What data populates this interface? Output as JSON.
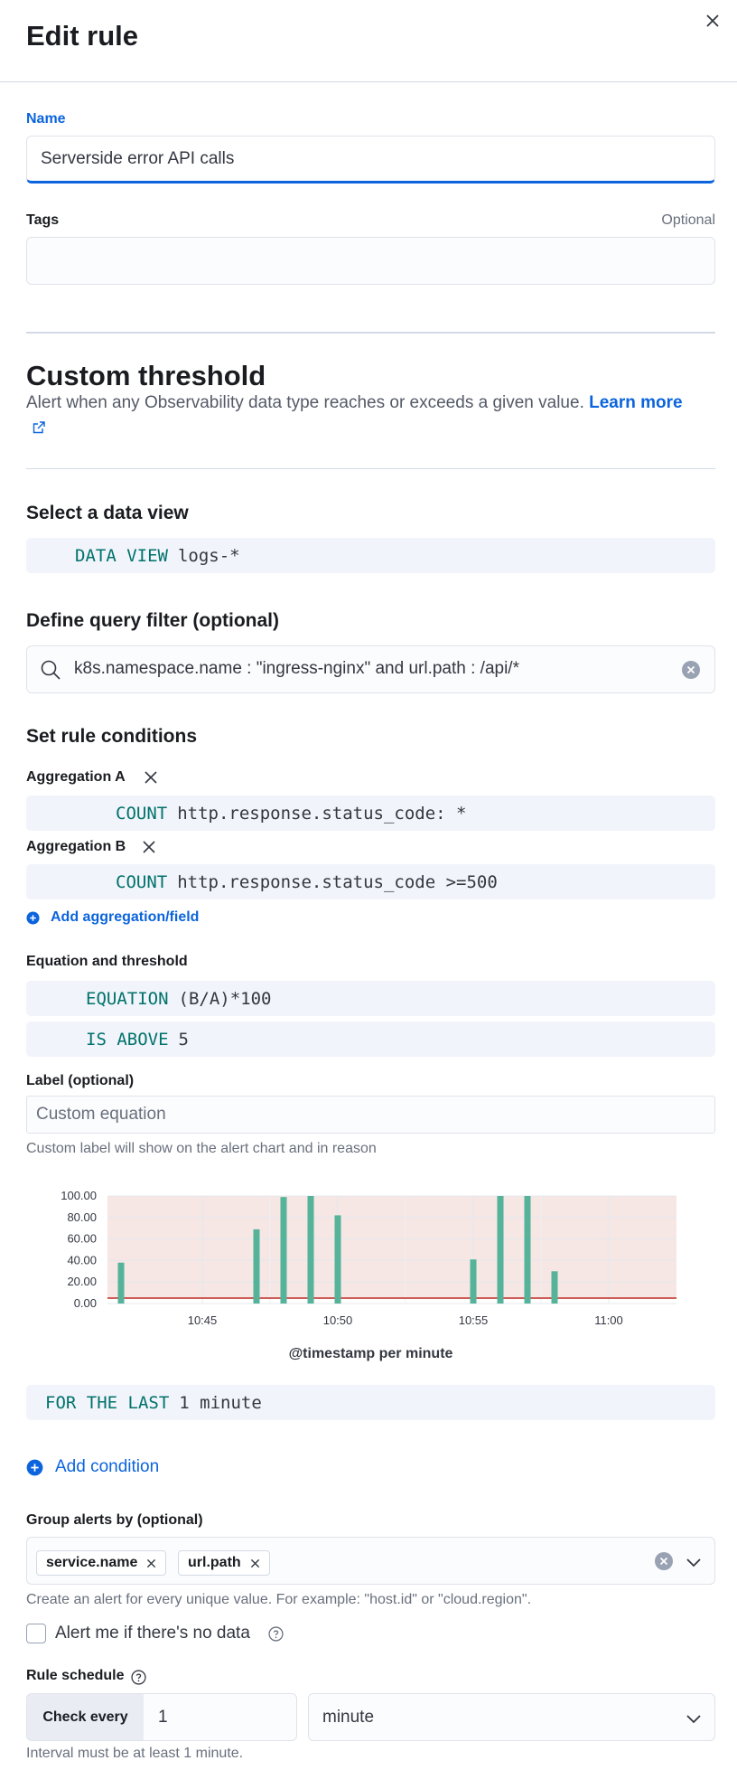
{
  "flyout": {
    "title": "Edit rule"
  },
  "name_field": {
    "label": "Name",
    "value": "Serverside error API calls"
  },
  "tags_field": {
    "label": "Tags",
    "optional": "Optional",
    "value": ""
  },
  "rule_type": {
    "title": "Custom threshold",
    "description": "Alert when any Observability data type reaches or exceeds a given value.",
    "learn_more": "Learn more"
  },
  "data_view": {
    "heading": "Select a data view",
    "keyword": "DATA VIEW",
    "value": "logs-*"
  },
  "query_filter": {
    "heading": "Define query filter (optional)",
    "query": "k8s.namespace.name : \"ingress-nginx\" and url.path : /api/*"
  },
  "conditions": {
    "heading": "Set rule conditions",
    "aggregations": [
      {
        "label": "Aggregation A",
        "keyword": "COUNT",
        "value": "http.response.status_code: *"
      },
      {
        "label": "Aggregation B",
        "keyword": "COUNT",
        "value": "http.response.status_code >=500"
      }
    ],
    "add_aggregation": "Add aggregation/field",
    "equation_heading": "Equation and threshold",
    "equation": {
      "keyword": "EQUATION",
      "value": "(B/A)*100"
    },
    "threshold": {
      "keyword": "IS ABOVE",
      "value": "5"
    },
    "label_field": {
      "label": "Label (optional)",
      "placeholder": "Custom equation",
      "help": "Custom label will show on the alert chart and in reason"
    },
    "time_window": {
      "keyword": "FOR THE LAST",
      "value": "1 minute"
    },
    "add_condition": "Add condition"
  },
  "chart_data": {
    "type": "bar",
    "xlabel": "@timestamp per minute",
    "ylim": [
      0,
      100
    ],
    "y_ticks": [
      "100.00",
      "80.00",
      "60.00",
      "40.00",
      "20.00",
      "0.00"
    ],
    "x_ticks": [
      "10:45",
      "10:50",
      "10:55",
      "11:00"
    ],
    "threshold": 5,
    "bars": [
      {
        "x": "10:42",
        "value": 38
      },
      {
        "x": "10:47",
        "value": 69
      },
      {
        "x": "10:48",
        "value": 99
      },
      {
        "x": "10:49",
        "value": 100
      },
      {
        "x": "10:50",
        "value": 82
      },
      {
        "x": "10:55",
        "value": 41
      },
      {
        "x": "10:56",
        "value": 100
      },
      {
        "x": "10:57",
        "value": 100
      },
      {
        "x": "10:58",
        "value": 30
      }
    ],
    "colors": {
      "bar": "#54b399",
      "threshold_area": "#f6e6e4",
      "threshold_line": "#bd271e"
    }
  },
  "group_by": {
    "label": "Group alerts by (optional)",
    "values": [
      "service.name",
      "url.path"
    ],
    "help": "Create an alert for every unique value. For example: \"host.id\" or \"cloud.region\"."
  },
  "no_data": {
    "label": "Alert me if there's no data",
    "checked": false
  },
  "schedule": {
    "label": "Rule schedule",
    "prepend": "Check every",
    "value": "1",
    "unit": "minute",
    "help": "Interval must be at least 1 minute."
  },
  "colors": {
    "primary": "#0b64dd",
    "keyword": "#00726b"
  }
}
